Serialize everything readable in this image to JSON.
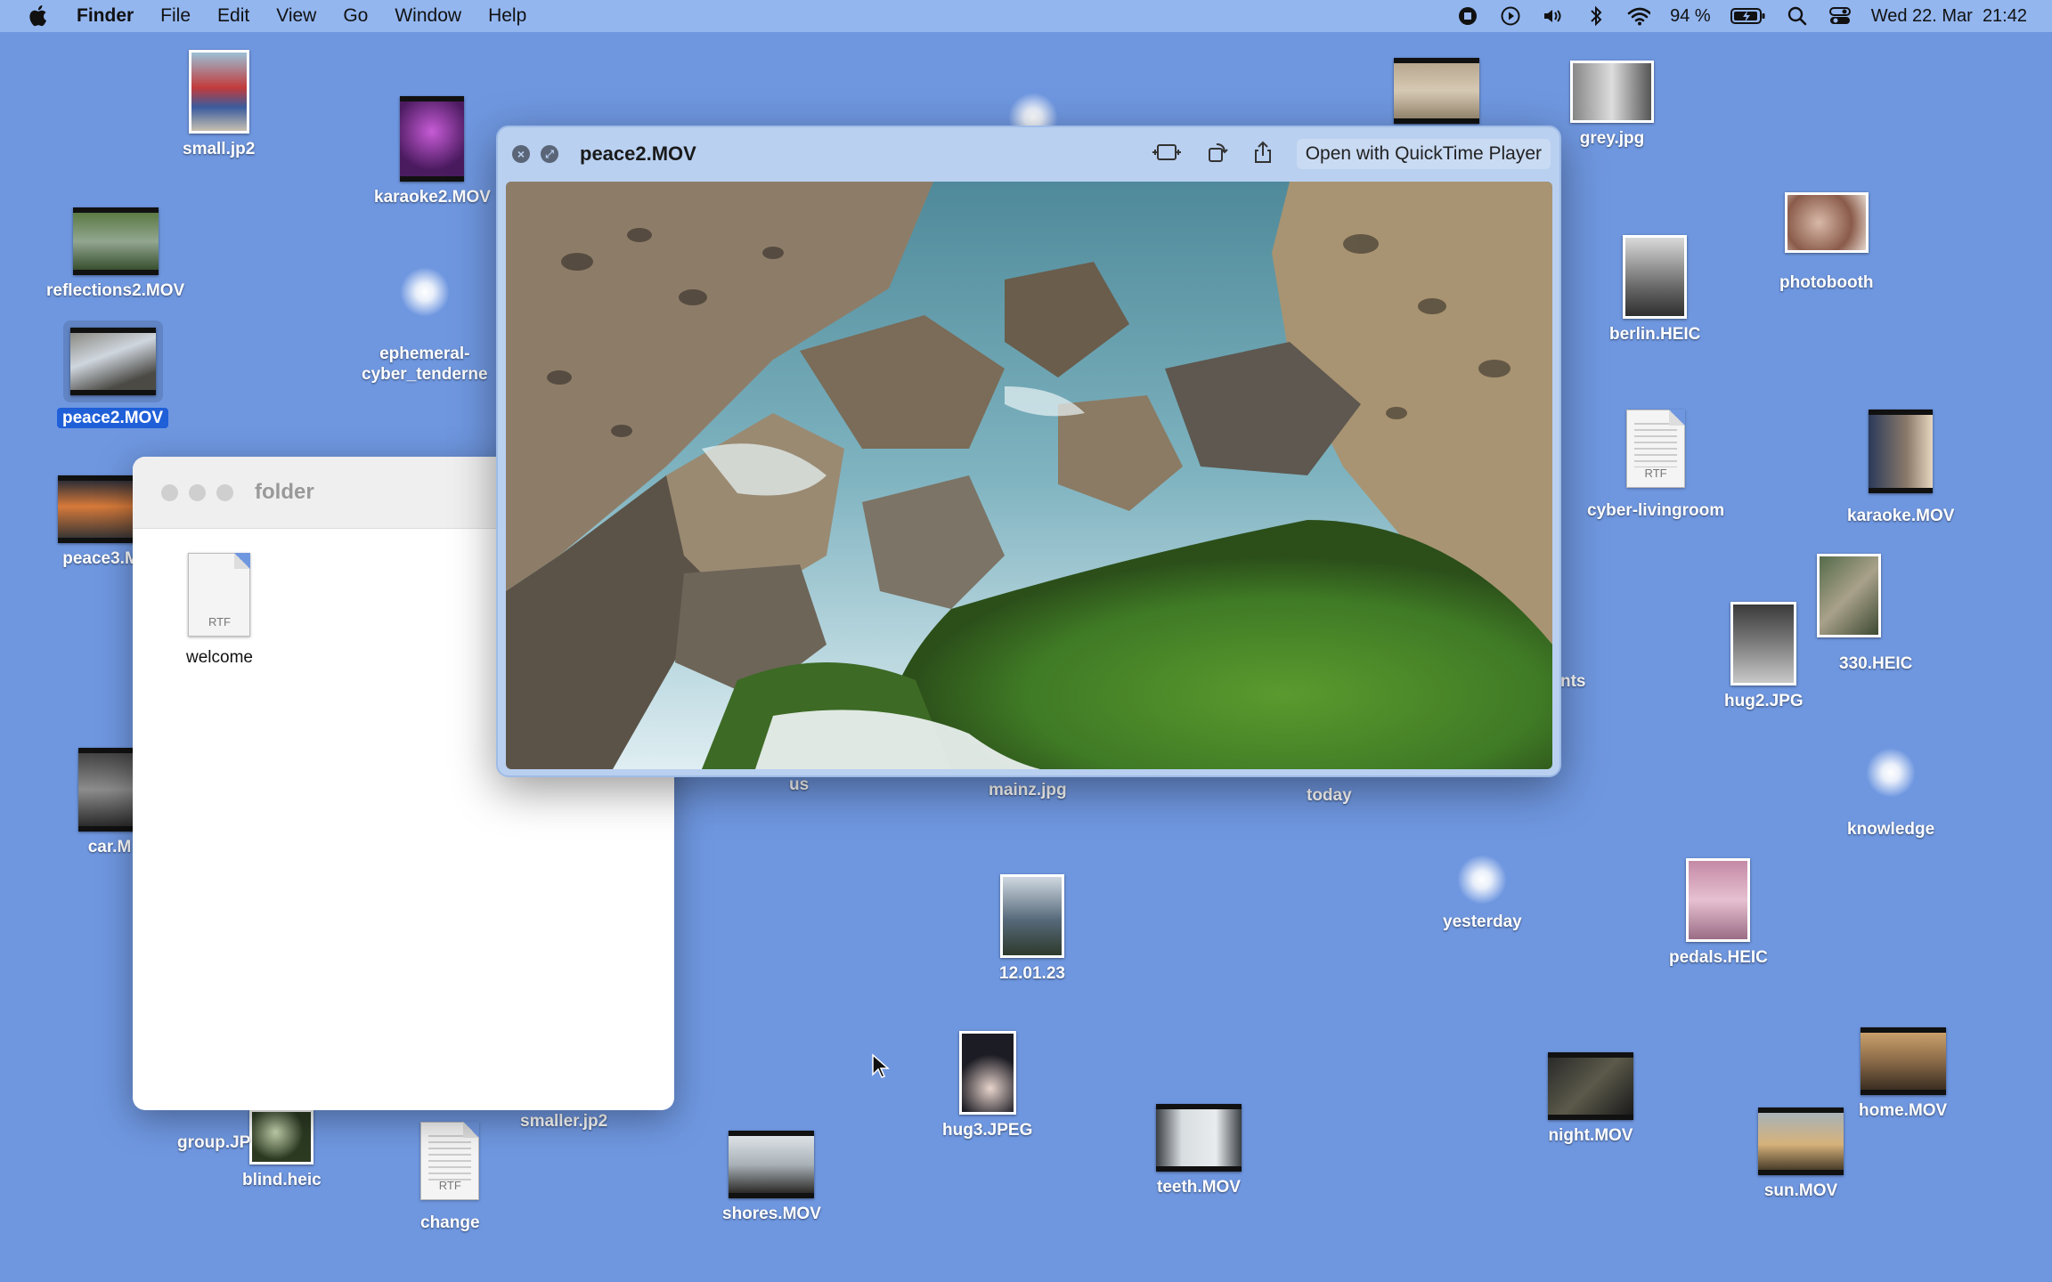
{
  "menubar": {
    "app": "Finder",
    "menus": [
      "File",
      "Edit",
      "View",
      "Go",
      "Window",
      "Help"
    ],
    "battery": "94 %",
    "clock": "Wed 22. Mar  21:42"
  },
  "desktop": {
    "icons": [
      {
        "label": "small.jp2"
      },
      {
        "label": "karaoke2.MOV"
      },
      {
        "label": "reflections2.MOV"
      },
      {
        "label": "ephemeral-\ncyber_tenderne"
      },
      {
        "label": "peace2.MOV"
      },
      {
        "label": "peace3.M"
      },
      {
        "label": "car.M"
      },
      {
        "label": "grey.jpg"
      },
      {
        "label": "photobooth"
      },
      {
        "label": "berlin.HEIC"
      },
      {
        "label": "cyber-livingroom"
      },
      {
        "label": "karaoke.MOV"
      },
      {
        "label": "330.HEIC"
      },
      {
        "label": "hug2.JPG"
      },
      {
        "label": "knowledge"
      },
      {
        "label": "nts"
      },
      {
        "label": "us"
      },
      {
        "label": "mainz.jpg"
      },
      {
        "label": "today"
      },
      {
        "label": "yesterday"
      },
      {
        "label": "pedals.HEIC"
      },
      {
        "label": "12.01.23"
      },
      {
        "label": "hug3.JPEG"
      },
      {
        "label": "night.MOV"
      },
      {
        "label": "home.MOV"
      },
      {
        "label": "sun.MOV"
      },
      {
        "label": "teeth.MOV"
      },
      {
        "label": "shores.MOV"
      },
      {
        "label": "change"
      },
      {
        "label": "blind.heic"
      },
      {
        "label": "group.JP"
      },
      {
        "label": "smaller.jp2"
      }
    ],
    "rtf_tag": "RTF"
  },
  "folder_window": {
    "title": "folder",
    "items": [
      {
        "label": "welcome",
        "tag": "RTF"
      }
    ]
  },
  "quicklook": {
    "title": "peace2.MOV",
    "open_button": "Open with QuickTime Player",
    "close_glyph": "×",
    "fullscreen_glyph": "⤢"
  },
  "colors": {
    "desktop": "#6f97e0",
    "selection": "#1f5fd8"
  }
}
